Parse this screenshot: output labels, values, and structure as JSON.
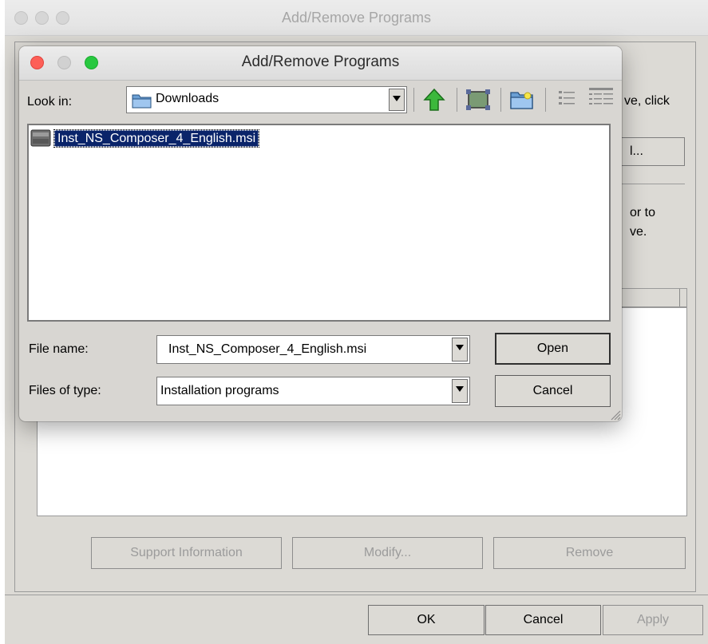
{
  "background_window": {
    "title": "Add/Remove Programs",
    "partial_texts": [
      "ve, click",
      "l...",
      "or to",
      "ve."
    ],
    "buttons": {
      "support": "Support Information",
      "modify": "Modify...",
      "remove": "Remove"
    },
    "footer": {
      "ok": "OK",
      "cancel": "Cancel",
      "apply": "Apply"
    }
  },
  "dialog": {
    "title": "Add/Remove Programs",
    "look_in_label": "Look in:",
    "look_in_value": "Downloads",
    "toolbar_icons": [
      "up-folder-icon",
      "network-icon",
      "new-folder-icon",
      "list-view-icon",
      "details-view-icon"
    ],
    "files": [
      {
        "name": "Inst_NS_Composer_4_English.msi",
        "selected": true
      }
    ],
    "file_name_label": "File name:",
    "file_name_value": "Inst_NS_Composer_4_English.msi",
    "file_type_label": "Files of type:",
    "file_type_value": "Installation programs",
    "open_label": "Open",
    "cancel_label": "Cancel"
  },
  "colors": {
    "selection_bg": "#0a246a",
    "window_bg": "#dcdad5",
    "close_button": "#fd5f57",
    "zoom_button": "#28c840"
  }
}
